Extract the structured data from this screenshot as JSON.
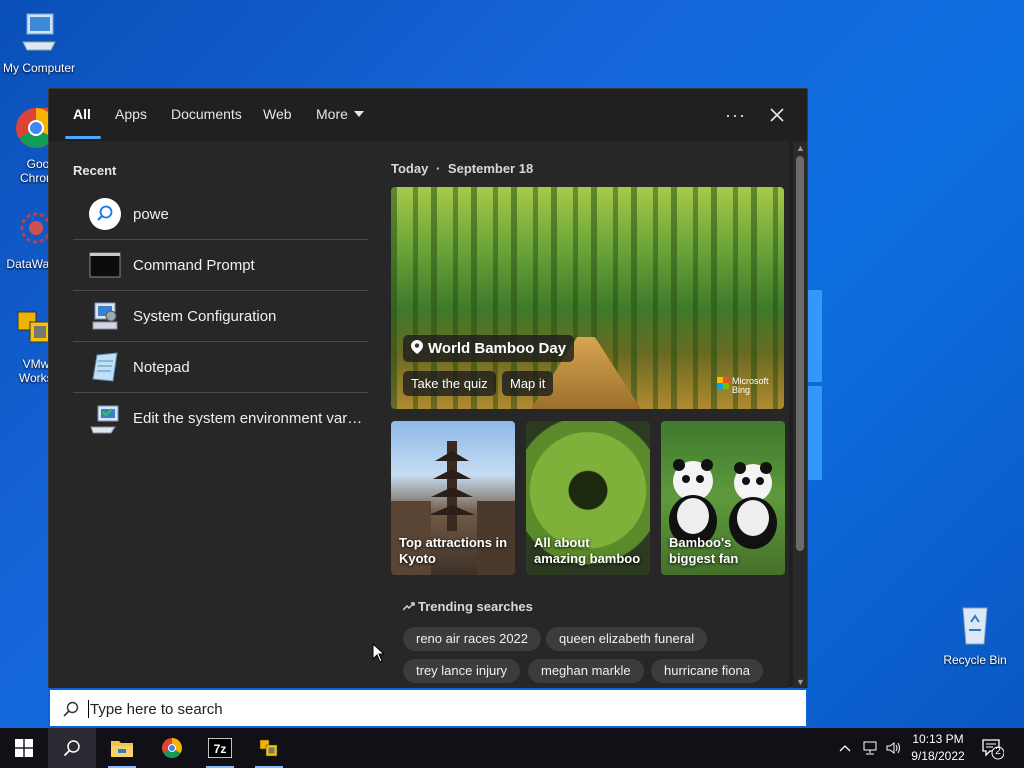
{
  "desktop": {
    "icons": [
      {
        "label": "My Computer"
      },
      {
        "label": "Goog Chrom"
      },
      {
        "label": "DataWag"
      },
      {
        "label": "VMwa Workst"
      },
      {
        "label": "Recycle Bin"
      }
    ]
  },
  "search_panel": {
    "tabs": [
      {
        "label": "All"
      },
      {
        "label": "Apps"
      },
      {
        "label": "Documents"
      },
      {
        "label": "Web"
      },
      {
        "label": "More"
      }
    ],
    "recent": {
      "heading": "Recent",
      "items": [
        {
          "label": "powe",
          "icon": "search-icon"
        },
        {
          "label": "Command Prompt",
          "icon": "command-prompt-icon"
        },
        {
          "label": "System Configuration",
          "icon": "system-configuration-icon"
        },
        {
          "label": "Notepad",
          "icon": "notepad-icon"
        },
        {
          "label": "Edit the system environment vari...",
          "icon": "system-properties-icon"
        }
      ]
    },
    "today": {
      "label": "Today",
      "separator": "·",
      "date": "September 18"
    },
    "hero": {
      "title": "World Bamboo Day",
      "actions": [
        "Take the quiz",
        "Map it"
      ],
      "brand_line1": "Microsoft",
      "brand_line2": "Bing"
    },
    "cards": [
      {
        "caption": "Top attractions in Kyoto"
      },
      {
        "caption": "All about amazing bamboo"
      },
      {
        "caption": "Bamboo's biggest fan"
      }
    ],
    "trending": {
      "heading": "Trending searches",
      "chips": [
        "reno air races 2022",
        "queen elizabeth funeral",
        "trey lance injury",
        "meghan markle",
        "hurricane fiona"
      ]
    }
  },
  "search_box": {
    "placeholder": "Type here to search",
    "value": ""
  },
  "taskbar": {
    "apps": [
      "start",
      "search",
      "file-explorer",
      "chrome",
      "7-zip",
      "vmware-workstation"
    ],
    "clock_time": "10:13 PM",
    "clock_date": "9/18/2022",
    "notification_count": "2"
  },
  "colors": {
    "accent": "#4aa8ff",
    "panel_bg": "#202020",
    "pane_bg": "#272727",
    "chip_bg": "#3c3c3c"
  }
}
